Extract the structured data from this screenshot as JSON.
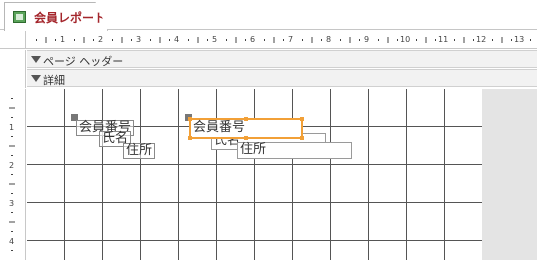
{
  "tab": {
    "label": "会員レポート",
    "icon": "report-icon"
  },
  "ruler": {
    "h_marks": [
      "1",
      "2",
      "3",
      "4",
      "5",
      "6",
      "7",
      "8",
      "9",
      "10",
      "11",
      "12",
      "13"
    ],
    "v_marks": [
      "1",
      "2",
      "3",
      "4"
    ]
  },
  "sections": {
    "page_header": "ページ ヘッダー",
    "detail": "詳細"
  },
  "controls": {
    "label_member_no": "会員番号",
    "label_name": "氏名",
    "label_address": "住所",
    "field_member_no": "会員番号",
    "field_name": "氏名",
    "field_address": "住所"
  },
  "colors": {
    "tab_text": "#a4262c",
    "selection": "#f2a037",
    "grid_line": "#555555"
  }
}
